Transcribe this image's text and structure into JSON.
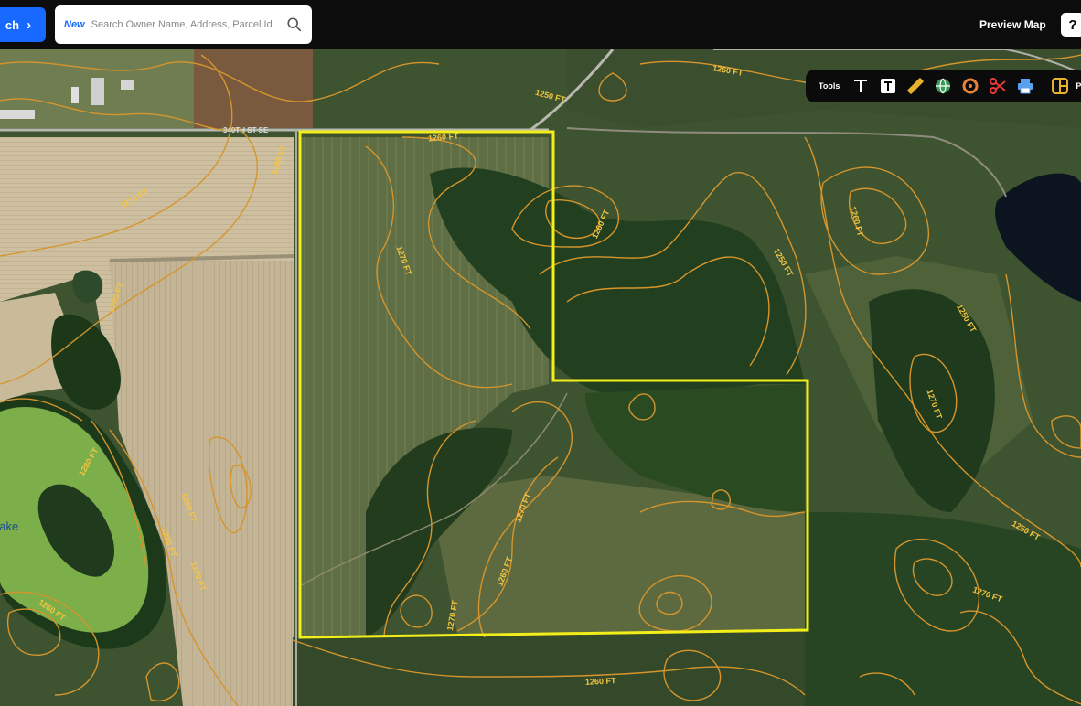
{
  "header": {
    "search_button_label": "ch",
    "search_new_badge": "New",
    "search_placeholder": "Search Owner Name, Address, Parcel Id",
    "preview_map_label": "Preview Map",
    "help_label": "?"
  },
  "toolbar": {
    "label": "Tools",
    "tools": [
      "text-tool-icon",
      "text-box-tool-icon",
      "measure-tool-icon",
      "globe-tool-icon",
      "radius-tool-icon",
      "scissors-tool-icon",
      "print-tool-icon",
      "layout-tool-icon"
    ],
    "partial_label": "P"
  },
  "map": {
    "road_label": "340TH ST SE",
    "lake_label": "Lake",
    "contour_labels": [
      "1250 FT",
      "1260 FT",
      "1260 FT",
      "1270 FT",
      "1270 FT",
      "1280 FT",
      "1280 FT",
      "1260 FT",
      "1250 FT",
      "1260 FT",
      "1250 FT",
      "1270 FT",
      "1270 FT",
      "1260 FT",
      "1250 FT",
      "1270 FT",
      "1260 FT",
      "1270 FT",
      "1260 FT",
      "1260 FT",
      "1280 FT",
      "1270 FT",
      "1280 FT"
    ],
    "colors": {
      "parcel_outline": "#f2ee1a",
      "contour": "#d6952c",
      "forest": "#1f3a1c",
      "field": "#b9a98a",
      "lake": "#7cae4a",
      "accent": "#1769ff"
    }
  }
}
